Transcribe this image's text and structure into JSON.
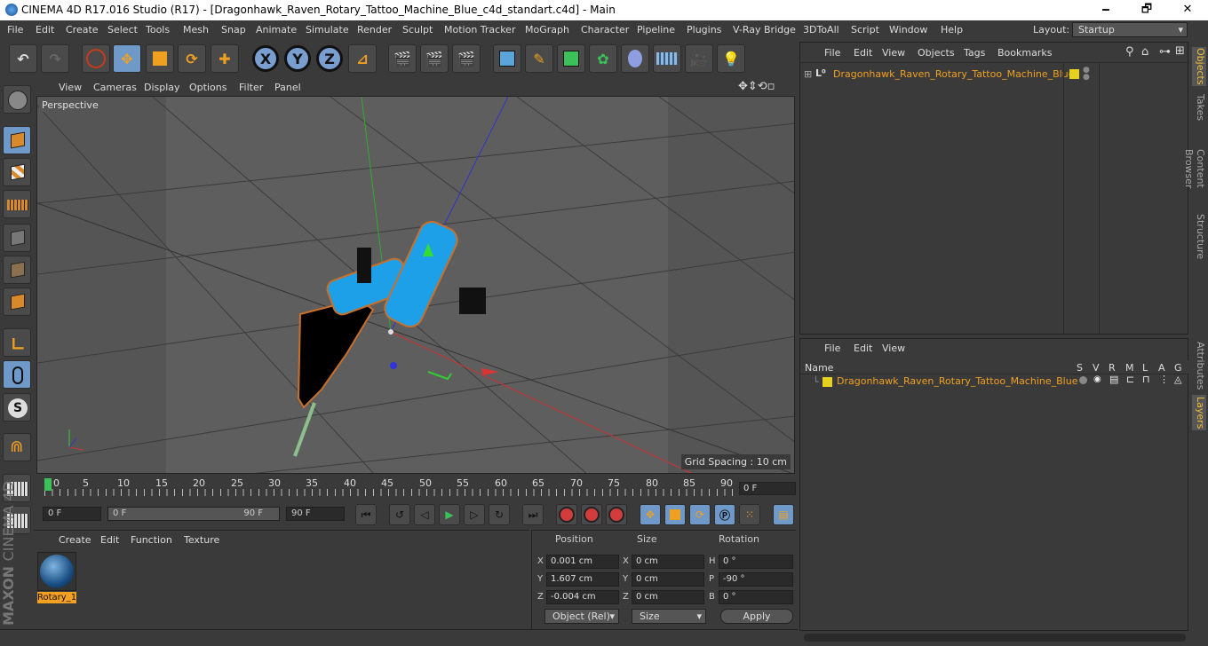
{
  "window": {
    "title": "CINEMA 4D R17.016 Studio (R17) - [Dragonhawk_Raven_Rotary_Tattoo_Machine_Blue_c4d_standart.c4d] - Main",
    "minimize": "🗕",
    "restore": "🗗",
    "close": "✕"
  },
  "menubar": {
    "items": [
      "File",
      "Edit",
      "Create",
      "Select",
      "Tools",
      "Mesh",
      "Snap",
      "Animate",
      "Simulate",
      "Render",
      "Sculpt",
      "Motion Tracker",
      "MoGraph",
      "Character",
      "Pipeline",
      "Plugins",
      "V-Ray Bridge",
      "3DToAll",
      "Script",
      "Window",
      "Help"
    ],
    "layout_label": "Layout:",
    "layout_value": "Startup"
  },
  "toolbar": {
    "x_label": "X",
    "y_label": "Y",
    "z_label": "Z"
  },
  "viewport": {
    "menu": [
      "View",
      "Cameras",
      "Display",
      "Options",
      "Filter",
      "Panel"
    ],
    "camera_label": "Perspective",
    "grid_spacing": "Grid Spacing : 10 cm"
  },
  "timeline": {
    "ticks": [
      "0",
      "5",
      "10",
      "15",
      "20",
      "25",
      "30",
      "35",
      "40",
      "45",
      "50",
      "55",
      "60",
      "65",
      "70",
      "75",
      "80",
      "85",
      "90"
    ],
    "current_frame": "0 F"
  },
  "transport": {
    "start_field": "0 F",
    "range_start": "0 F",
    "range_end": "90 F",
    "end_field": "90 F"
  },
  "material_manager": {
    "menu": [
      "Create",
      "Edit",
      "Function",
      "Texture"
    ],
    "material_name": "Rotary_1"
  },
  "coordinates": {
    "headers": {
      "position": "Position",
      "size": "Size",
      "rotation": "Rotation"
    },
    "rows": [
      {
        "axis": "X",
        "pos": "0.001 cm",
        "size_axis": "X",
        "size": "0 cm",
        "rot_axis": "H",
        "rot": "0 °"
      },
      {
        "axis": "Y",
        "pos": "1.607 cm",
        "size_axis": "Y",
        "size": "0 cm",
        "rot_axis": "P",
        "rot": "-90 °"
      },
      {
        "axis": "Z",
        "pos": "-0.004 cm",
        "size_axis": "Z",
        "size": "0 cm",
        "rot_axis": "B",
        "rot": "0 °"
      }
    ],
    "mode_select": "Object (Rel)",
    "size_select": "Size",
    "apply": "Apply"
  },
  "object_manager": {
    "menu": [
      "File",
      "Edit",
      "View",
      "Objects",
      "Tags",
      "Bookmarks"
    ],
    "object_name": "Dragonhawk_Raven_Rotary_Tattoo_Machine_Blue"
  },
  "layer_manager": {
    "menu": [
      "File",
      "Edit",
      "View"
    ],
    "name_header": "Name",
    "flags": [
      "S",
      "V",
      "R",
      "M",
      "L",
      "A",
      "G"
    ],
    "layer_name": "Dragonhawk_Raven_Rotary_Tattoo_Machine_Blue"
  },
  "side_tabs": {
    "top": [
      "Objects",
      "Takes",
      "Content Browser",
      "Structure"
    ],
    "bottom": [
      "Attributes",
      "Layers"
    ]
  },
  "brand": {
    "maxon": "MAXON",
    "product": "CINEMA 4D"
  },
  "colors": {
    "accent_blue": "#6e99c9",
    "object_orange": "#f0a020",
    "layer_yellow": "#e6d21e"
  }
}
